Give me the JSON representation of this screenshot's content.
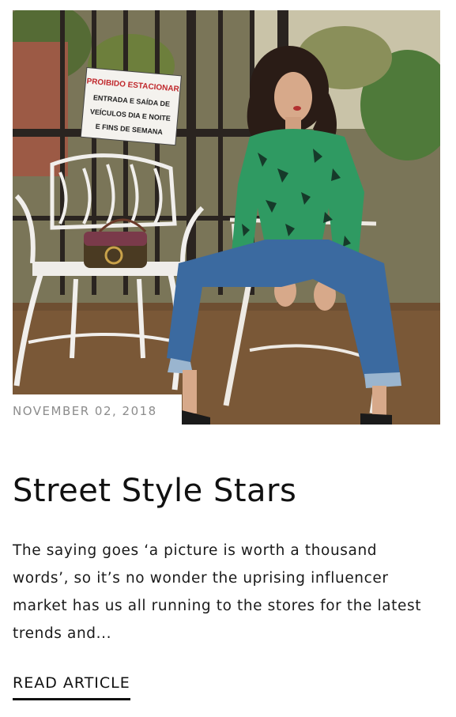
{
  "post": {
    "date": "NOVEMBER 02, 2018",
    "title": "Street Style Stars",
    "excerpt": "The saying goes ‘a picture is worth a thousand words’, so it’s no wonder the uprising influencer market has us all running to the stores for the latest trends and...",
    "read_more": "READ ARTICLE"
  },
  "photo": {
    "sign_lines": [
      "PROIBIDO ESTACIONAR",
      "ENTRADA E SAÍDA DE",
      "VEÍCULOS DIA E NOITE",
      "E FINS DE SEMANA"
    ]
  },
  "colors": {
    "date_text": "#8c8c8c",
    "title_text": "#111111",
    "body_text": "#1a1a1a",
    "underline": "#111111",
    "background": "#ffffff"
  }
}
